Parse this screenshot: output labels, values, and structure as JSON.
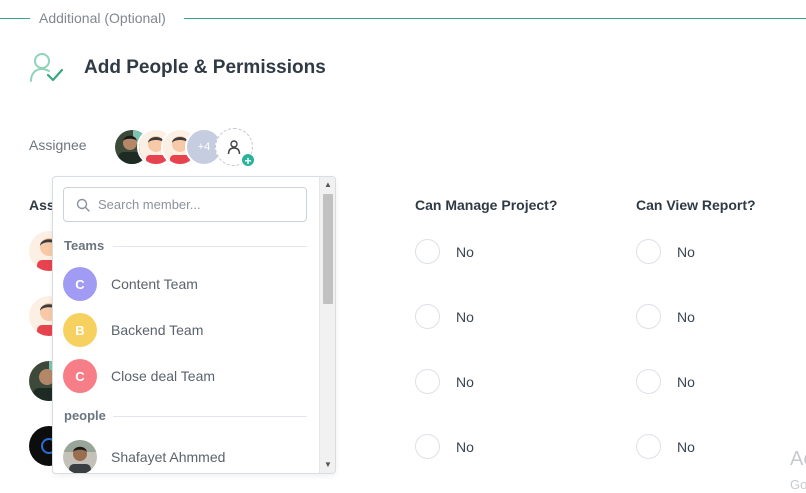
{
  "section": {
    "label": "Additional (Optional)"
  },
  "header": {
    "title": "Add People & Permissions",
    "icon": "user-check-icon"
  },
  "assignee": {
    "label": "Assignee",
    "more_count": "+4"
  },
  "columns": {
    "assignee": "Assignee",
    "manage": "Can Manage Project?",
    "report": "Can View Report?"
  },
  "rows": [
    {
      "manage": "No",
      "report": "No"
    },
    {
      "manage": "No",
      "report": "No"
    },
    {
      "manage": "No",
      "report": "No"
    },
    {
      "manage": "No",
      "report": "No"
    }
  ],
  "dropdown": {
    "search_placeholder": "Search member...",
    "teams_label": "Teams",
    "people_label": "people",
    "teams": [
      {
        "initial": "C",
        "name": "Content Team",
        "color": "#a29bf4"
      },
      {
        "initial": "B",
        "name": "Backend Team",
        "color": "#f7d160"
      },
      {
        "initial": "C",
        "name": "Close deal Team",
        "color": "#f77e86"
      }
    ],
    "people": [
      {
        "name": "Shafayet Ahmmed"
      }
    ]
  },
  "watermark": {
    "line1": "Ac",
    "line2": "Go"
  },
  "colors": {
    "accent": "#3aa783",
    "add_badge": "#2bb39a"
  }
}
